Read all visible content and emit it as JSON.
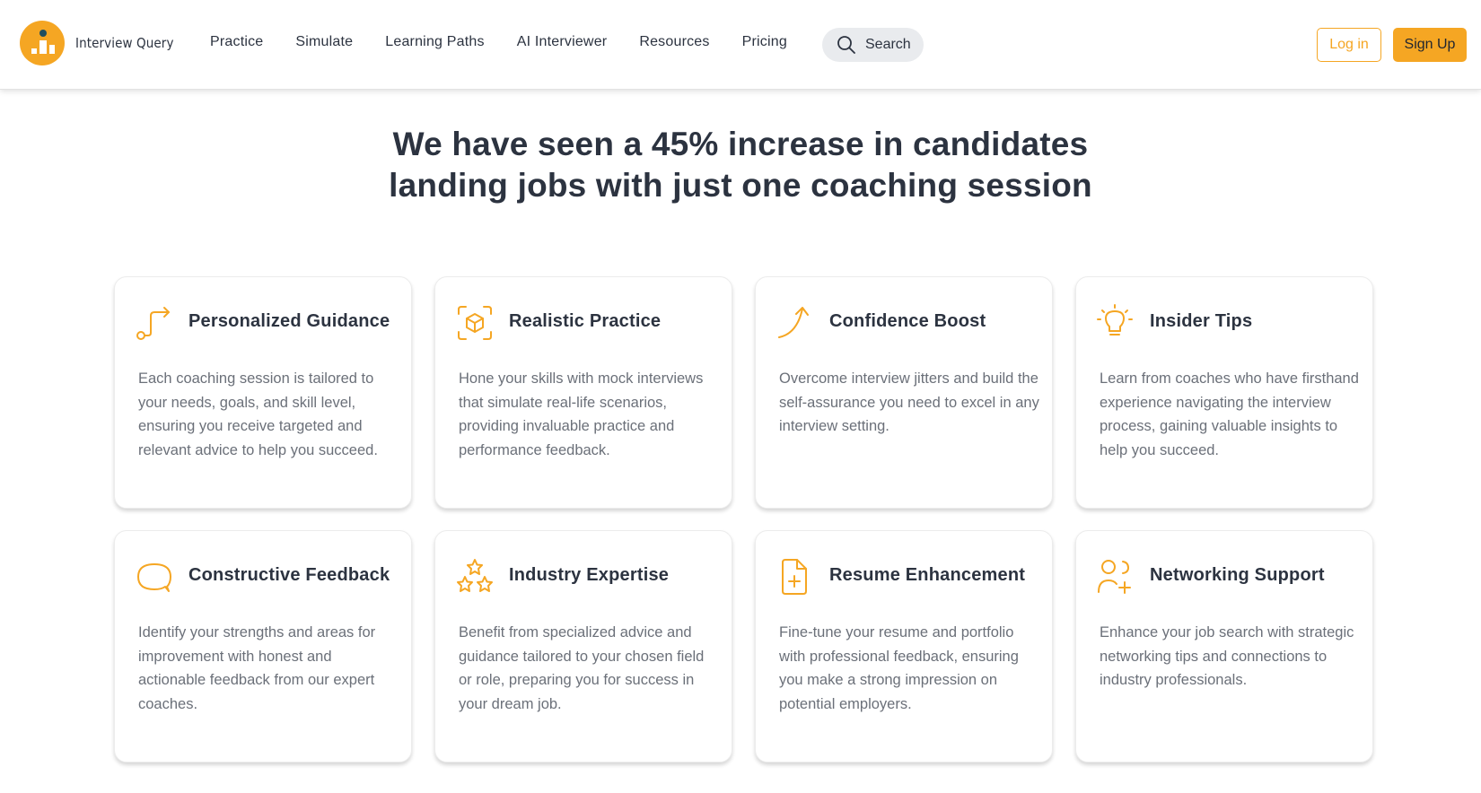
{
  "brand": {
    "name": "Interview Query",
    "accent": "#f5a623",
    "text_color": "#2c3340"
  },
  "nav": {
    "items": [
      {
        "label": "Practice"
      },
      {
        "label": "Simulate"
      },
      {
        "label": "Learning Paths"
      },
      {
        "label": "AI Interviewer"
      },
      {
        "label": "Resources"
      },
      {
        "label": "Pricing"
      }
    ],
    "search_label": "Search",
    "login_label": "Log in",
    "signup_label": "Sign Up"
  },
  "headline": {
    "line1": "We have seen a 45% increase in candidates",
    "line2": "landing jobs with just one coaching session"
  },
  "cards": [
    {
      "icon": "route-arrow-icon",
      "title": "Personalized Guidance",
      "description": "Each coaching session is tailored to your needs, goals, and skill level, ensuring you receive targeted and relevant advice to help you succeed."
    },
    {
      "icon": "cube-scan-icon",
      "title": "Realistic Practice",
      "description": "Hone your skills with mock interviews that simulate real-life scenarios, providing invaluable practice and performance feedback."
    },
    {
      "icon": "trend-arrow-icon",
      "title": "Confidence Boost",
      "description": "Overcome interview jitters and build the self-assurance you need to excel in any interview setting."
    },
    {
      "icon": "lightbulb-icon",
      "title": "Insider Tips",
      "description": "Learn from coaches who have firsthand experience navigating the interview process, gaining valuable insights to help you succeed."
    },
    {
      "icon": "chat-bubble-icon",
      "title": "Constructive Feedback",
      "description": "Identify your strengths and areas for improvement with honest and actionable feedback from our expert coaches."
    },
    {
      "icon": "stars-icon",
      "title": "Industry Expertise",
      "description": "Benefit from specialized advice and guidance tailored to your chosen field or role, preparing you for success in your dream job."
    },
    {
      "icon": "document-add-icon",
      "title": "Resume Enhancement",
      "description": "Fine-tune your resume and portfolio with professional feedback, ensuring you make a strong impression on potential employers."
    },
    {
      "icon": "users-add-icon",
      "title": "Networking Support",
      "description": "Enhance your job search with strategic networking tips and connections to industry professionals."
    }
  ]
}
